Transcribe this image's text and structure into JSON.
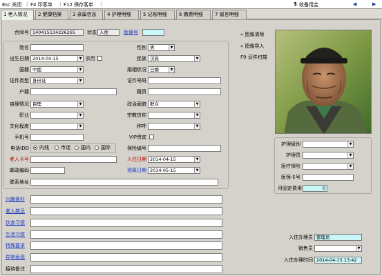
{
  "topbar": {
    "items": [
      "Esc 关闭",
      "F4 印客单",
      "F12 保存客单"
    ],
    "right_item": "收备用金",
    "icons": {
      "coin": "$",
      "back": "◀",
      "forward": "▶"
    }
  },
  "tabs": [
    "1 老人情况",
    "2 健康档案",
    "3 亲属信息",
    "4 护理明细",
    "5 记账明细",
    "6 缴费明细",
    "7 留言明细"
  ],
  "contract": {
    "label": "合同号",
    "value": "140415134226265",
    "status_label": "状态",
    "status_value": "入住",
    "insurance_label": "医保号",
    "insurance_value": ""
  },
  "form": {
    "name": {
      "label": "姓名",
      "value": ""
    },
    "gender": {
      "label": "性别",
      "value": "男"
    },
    "birthdate": {
      "label": "出生日期",
      "value": "2014-04-15"
    },
    "lunar": {
      "label": "农历"
    },
    "ethnicity": {
      "label": "民族",
      "value": "汉族"
    },
    "nationality": {
      "label": "国籍",
      "value": "中国"
    },
    "marital": {
      "label": "婚姻状况",
      "value": "已婚"
    },
    "id_type": {
      "label": "证件类型",
      "value": "身份证"
    },
    "id_number": {
      "label": "证件号码",
      "value": ""
    },
    "household": {
      "label": "户籍",
      "value": ""
    },
    "native_place": {
      "label": "籍贯",
      "value": ""
    },
    "self_care": {
      "label": "自理情况",
      "value": "自理"
    },
    "political": {
      "label": "政治面貌",
      "value": "群众"
    },
    "occupation": {
      "label": "职业",
      "value": ""
    },
    "religion": {
      "label": "宗教信仰",
      "value": ""
    },
    "education": {
      "label": "文化程度",
      "value": ""
    },
    "title_role": {
      "label": "称呼",
      "value": ""
    },
    "vip": {
      "label": "VIP贵宾"
    },
    "mobile": {
      "label": "手机号",
      "value": ""
    },
    "phone_idd": {
      "label": "电话IDD",
      "options": [
        "内线",
        "市话",
        "国内",
        "国际"
      ]
    },
    "insurance_no": {
      "label": "保险编号",
      "value": ""
    },
    "elder_card": {
      "label": "老人卡号",
      "value": ""
    },
    "checkin_date": {
      "label": "入住日期",
      "value": "2014-04-15"
    },
    "zip": {
      "label": "邮政编码",
      "value": ""
    },
    "leave_date": {
      "label": "预离日期",
      "value": "2014-05-15"
    },
    "address": {
      "label": "联系地址",
      "value": ""
    }
  },
  "bottom": {
    "hobbies": "兴趣爱好",
    "taboos": "老人禁忌",
    "diet": "饮食习惯",
    "habits": "生活习惯",
    "special": "特殊要求",
    "abnormal": "异常表现",
    "remarks": "接待备注"
  },
  "actions": {
    "clear": "图像清除",
    "import": "图像导入",
    "scan": "F9 证件扫描"
  },
  "right": {
    "care_level": {
      "label": "护理级别",
      "value": ""
    },
    "caregiver": {
      "label": "护理员",
      "value": ""
    },
    "med_insurance": {
      "label": "医疗保险",
      "value": ""
    },
    "med_card": {
      "label": "医保卡号",
      "value": ""
    },
    "monthly_fee": {
      "label": "月固定费用",
      "value": "0"
    }
  },
  "handler": {
    "label": "入住办理员",
    "value": "管理员"
  },
  "seller": {
    "label": "销售员",
    "value": ""
  },
  "handled_time": {
    "label": "入住办理时间",
    "value": "2014-04-15 13:42"
  }
}
